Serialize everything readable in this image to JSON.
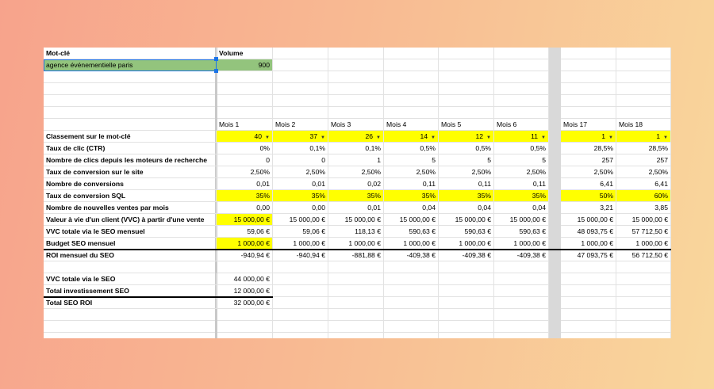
{
  "header": {
    "keyword_label": "Mot-clé",
    "volume_label": "Volume"
  },
  "keyword_row": {
    "keyword": "agence événementielle paris",
    "volume": "900"
  },
  "months": [
    "Mois 1",
    "Mois 2",
    "Mois 3",
    "Mois 4",
    "Mois 5",
    "Mois 6",
    "Mois 17",
    "Mois 18"
  ],
  "rows": [
    {
      "label": "Classement sur le mot-clé",
      "values": [
        "40",
        "37",
        "26",
        "14",
        "12",
        "11",
        "1",
        "1"
      ],
      "highlight": true,
      "dropdown": true
    },
    {
      "label": "Taux de clic (CTR)",
      "values": [
        "0%",
        "0,1%",
        "0,1%",
        "0,5%",
        "0,5%",
        "0,5%",
        "28,5%",
        "28,5%"
      ]
    },
    {
      "label": "Nombre de clics depuis les moteurs de recherche",
      "values": [
        "0",
        "0",
        "1",
        "5",
        "5",
        "5",
        "257",
        "257"
      ]
    },
    {
      "label": "Taux de conversion sur le site",
      "values": [
        "2,50%",
        "2,50%",
        "2,50%",
        "2,50%",
        "2,50%",
        "2,50%",
        "2,50%",
        "2,50%"
      ]
    },
    {
      "label": "Nombre de conversions",
      "values": [
        "0,01",
        "0,01",
        "0,02",
        "0,11",
        "0,11",
        "0,11",
        "6,41",
        "6,41"
      ]
    },
    {
      "label": "Taux de conversion SQL",
      "values": [
        "35%",
        "35%",
        "35%",
        "35%",
        "35%",
        "35%",
        "50%",
        "60%"
      ],
      "highlight": true
    },
    {
      "label": "Nombre de nouvelles ventes par mois",
      "values": [
        "0,00",
        "0,00",
        "0,01",
        "0,04",
        "0,04",
        "0,04",
        "3,21",
        "3,85"
      ]
    },
    {
      "label": "Valeur à vie d'un client (VVC) à partir d'une vente",
      "values": [
        "15 000,00 €",
        "15 000,00 €",
        "15 000,00 €",
        "15 000,00 €",
        "15 000,00 €",
        "15 000,00 €",
        "15 000,00 €",
        "15 000,00 €"
      ],
      "highlight_first": true
    },
    {
      "label": "VVC totale via le SEO mensuel",
      "values": [
        "59,06 €",
        "59,06 €",
        "118,13 €",
        "590,63 €",
        "590,63 €",
        "590,63 €",
        "48 093,75 €",
        "57 712,50 €"
      ]
    },
    {
      "label": "Budget SEO mensuel",
      "values": [
        "1 000,00 €",
        "1 000,00 €",
        "1 000,00 €",
        "1 000,00 €",
        "1 000,00 €",
        "1 000,00 €",
        "1 000,00 €",
        "1 000,00 €"
      ],
      "highlight_first": true
    },
    {
      "label": "ROI mensuel du SEO",
      "values": [
        "-940,94 €",
        "-940,94 €",
        "-881,88 €",
        "-409,38 €",
        "-409,38 €",
        "-409,38 €",
        "47 093,75 €",
        "56 712,50 €"
      ]
    }
  ],
  "summary": [
    {
      "label": "VVC totale via le SEO",
      "value": "44 000,00 €"
    },
    {
      "label": "Total investissement SEO",
      "value": "12 000,00 €"
    },
    {
      "label": "Total SEO ROI",
      "value": "32 000,00 €"
    }
  ],
  "colors": {
    "highlight": "#ffff00",
    "keyword_fill": "#93c47d",
    "selection": "#1a73e8",
    "gridline": "#e2e2e2"
  }
}
